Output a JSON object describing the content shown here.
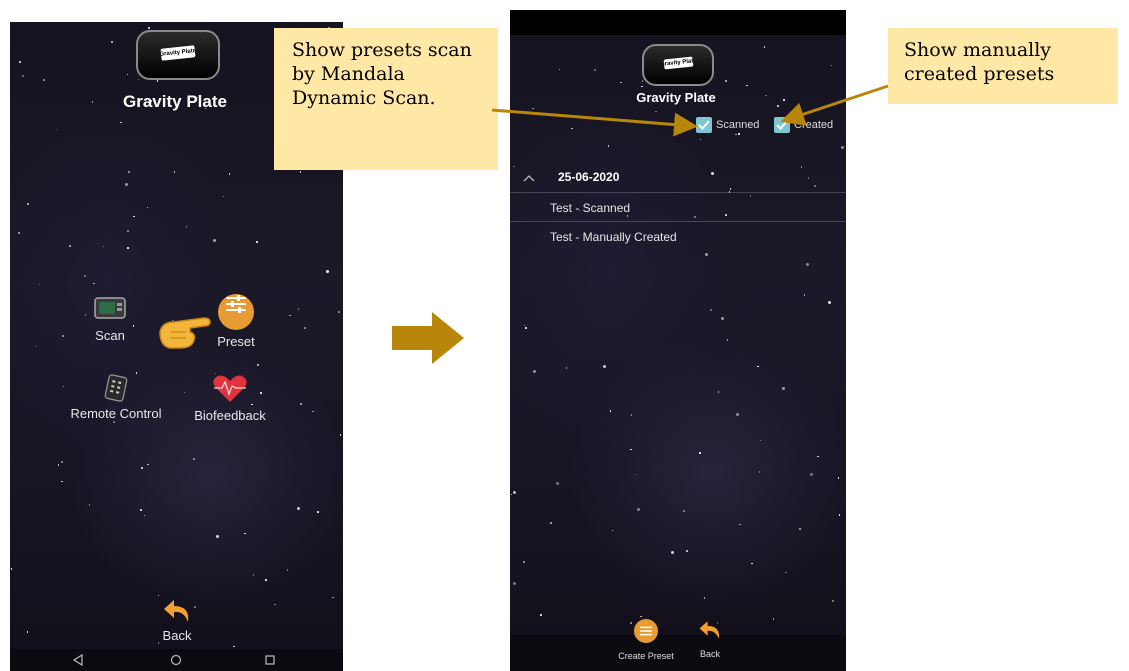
{
  "left_screen": {
    "device_label": "Gravity Plate",
    "app_title": "Gravity Plate",
    "menu": {
      "scan": "Scan",
      "preset": "Preset",
      "remote_control": "Remote Control",
      "biofeedback": "Biofeedback"
    },
    "back_label": "Back",
    "nav": {
      "back_icon": "triangle-back-icon",
      "home_icon": "circle-home-icon",
      "recents_icon": "square-recents-icon"
    }
  },
  "right_screen": {
    "device_label": "Gravity Plate",
    "app_title": "Gravity Plate",
    "filters": {
      "scanned_label": "Scanned",
      "scanned_checked": true,
      "created_label": "Created",
      "created_checked": true
    },
    "group": {
      "date": "25-06-2020",
      "expanded": true
    },
    "presets": [
      "Test - Scanned",
      "Test - Manually Created"
    ],
    "bottom": {
      "create_preset_label": "Create Preset",
      "back_label": "Back"
    }
  },
  "callouts": {
    "left": "Show presets scan by Mandala Dynamic Scan.",
    "right": "Show manually created presets"
  },
  "colors": {
    "callout_bg": "#ffe8a6",
    "arrow": "#b8860b",
    "accent_orange": "#e79b32",
    "checkbox": "#7fc6d0"
  }
}
